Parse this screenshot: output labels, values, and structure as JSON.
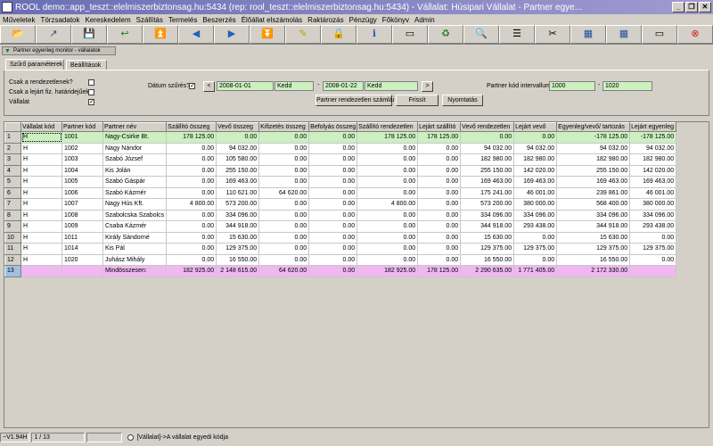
{
  "window": {
    "title": "ROOL demo::app_teszt::elelmiszerbiztonsag.hu:5434 (rep: rool_teszt::elelmiszerbiztonsag.hu:5434) - Vállalat: Húsipari Vállalat - Partner egye..."
  },
  "menu": [
    "Műveletek",
    "Törzsadatok",
    "Kereskedelem",
    "Szállítás",
    "Termelés",
    "Beszerzés",
    "Élőállat elszámolás",
    "Raktározás",
    "Pénzügy",
    "Főkönyv",
    "Admin"
  ],
  "toolbar": {
    "icons": [
      "📂",
      "↗",
      "💾",
      "↩",
      "⏫",
      "◀",
      "▶",
      "⏬",
      "✎",
      "🔒",
      "ℹ",
      "▭",
      "♻",
      "🔍",
      "☰",
      "✂",
      "▦",
      "▦",
      "▭",
      "⊗"
    ]
  },
  "monitor_tab": {
    "label": "Partner egyenleg monitor - vállalatok"
  },
  "subtabs": [
    "Szűrő paraméterek",
    "Beállítások"
  ],
  "filters": {
    "only_ordered_label": "Csak a rendezetlenek?",
    "only_expired_label": "Csak a lejárt fiz. határidejűek?",
    "company_label": "Vállalat",
    "company_checked": "✓",
    "date_filter_label": "Dátum szűrés?",
    "date_filter_checked": "✓",
    "prev_btn": "<",
    "next_btn": ">",
    "date_from": "2008-01-01",
    "day_from": "Kedd",
    "date_to": "2008-01-22",
    "day_to": "Kedd",
    "range_sep": "-",
    "partner_code_label": "Partner kód intervallum",
    "partner_code_from": "1000",
    "partner_code_to": "1020",
    "btn_count": "Partner rendezetlen számlái",
    "btn_refresh": "Frissít",
    "btn_print": "Nyomtatás"
  },
  "table": {
    "columns": [
      "Vállalat kód",
      "Partner kód",
      "Partner név",
      "Szállító összeg",
      "Vevő összeg",
      "Kifizetés összeg",
      "Befolyás összeg",
      "Szállító rendezetlen",
      "Lejárt szállító",
      "Vevő rendezetlen",
      "Lejárt vevő",
      "Egyenleg/vevő/ tartozás",
      "Lejárt egyenleg"
    ],
    "rows": [
      [
        "1",
        "H",
        "1001",
        "Nagy-Csirke Bt.",
        "178 125.00",
        "0.00",
        "0.00",
        "0.00",
        "178 125.00",
        "178 125.00",
        "0.00",
        "0.00",
        "-178 125.00",
        "-178 125.00"
      ],
      [
        "2",
        "H",
        "1002",
        "Nagy Nándor",
        "0.00",
        "94 032.00",
        "0.00",
        "0.00",
        "0.00",
        "0.00",
        "94 032.00",
        "94 032.00",
        "94 032.00",
        "94 032.00"
      ],
      [
        "3",
        "H",
        "1003",
        "Szabó József",
        "0.00",
        "105 580.00",
        "0.00",
        "0.00",
        "0.00",
        "0.00",
        "182 980.00",
        "182 980.00",
        "182 980.00",
        "182 980.00"
      ],
      [
        "4",
        "H",
        "1004",
        "Kis Jolán",
        "0.00",
        "255 150.00",
        "0.00",
        "0.00",
        "0.00",
        "0.00",
        "255 150.00",
        "142 020.00",
        "255 150.00",
        "142 020.00"
      ],
      [
        "5",
        "H",
        "1005",
        "Szabó Gáspár",
        "0.00",
        "169 463.00",
        "0.00",
        "0.00",
        "0.00",
        "0.00",
        "169 463.00",
        "169 463.00",
        "169 463.00",
        "169 463.00"
      ],
      [
        "6",
        "H",
        "1006",
        "Szabó Kázmér",
        "0.00",
        "110 621.00",
        "64 620.00",
        "0.00",
        "0.00",
        "0.00",
        "175 241.00",
        "46 001.00",
        "239 861.00",
        "46 001.00"
      ],
      [
        "7",
        "H",
        "1007",
        "Nagy Hús Kft.",
        "4 800.00",
        "573 200.00",
        "0.00",
        "0.00",
        "4 800.00",
        "0.00",
        "573 200.00",
        "380 000.00",
        "568 400.00",
        "380 000.00"
      ],
      [
        "8",
        "H",
        "1008",
        "Szabolcska Szabolcs",
        "0.00",
        "334 096.00",
        "0.00",
        "0.00",
        "0.00",
        "0.00",
        "334 096.00",
        "334 096.00",
        "334 096.00",
        "334 096.00"
      ],
      [
        "9",
        "H",
        "1009",
        "Csaba Kázmér",
        "0.00",
        "344 918.00",
        "0.00",
        "0.00",
        "0.00",
        "0.00",
        "344 918.00",
        "293 438.00",
        "344 918.00",
        "293 438.00"
      ],
      [
        "10",
        "H",
        "1011",
        "Király Sándorné",
        "0.00",
        "15 630.00",
        "0.00",
        "0.00",
        "0.00",
        "0.00",
        "15 630.00",
        "0.00",
        "15 630.00",
        "0.00"
      ],
      [
        "11",
        "H",
        "1014",
        "Kis Pál",
        "0.00",
        "129 375.00",
        "0.00",
        "0.00",
        "0.00",
        "0.00",
        "129 375.00",
        "129 375.00",
        "129 375.00",
        "129 375.00"
      ],
      [
        "12",
        "H",
        "1020",
        "Juhász Mihály",
        "0.00",
        "16 550.00",
        "0.00",
        "0.00",
        "0.00",
        "0.00",
        "16 550.00",
        "0.00",
        "16 550.00",
        "0.00"
      ],
      [
        "13",
        "",
        "",
        "Mindösszesen:",
        "182 925.00",
        "2 148 615.00",
        "64 620.00",
        "0.00",
        "182 925.00",
        "178 125.00",
        "2 290 635.00",
        "1 771 405.00",
        "2 172 330.00",
        ""
      ]
    ]
  },
  "status": {
    "version": "~V1.94H",
    "position": "1 / 13",
    "hint": "[Vállalat]->A vállalat egyedi kódja"
  }
}
